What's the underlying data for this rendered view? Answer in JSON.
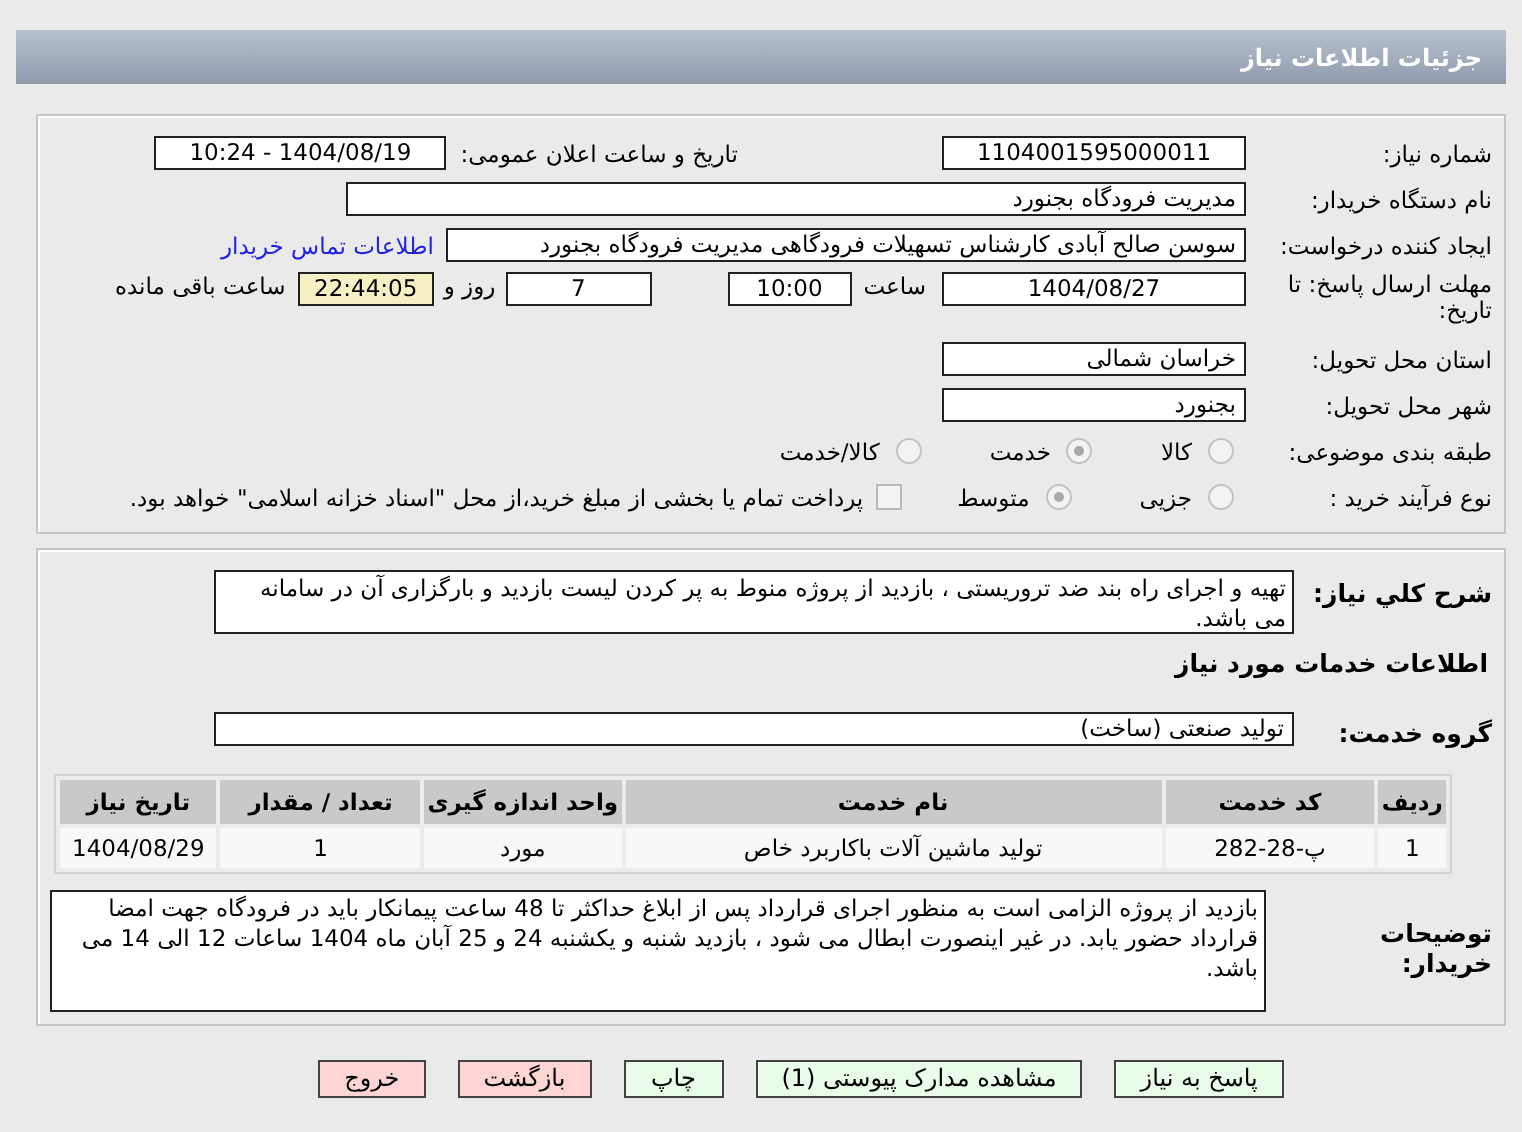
{
  "header": {
    "title": "جزئیات اطلاعات نیاز"
  },
  "details": {
    "need_number": {
      "label": "شماره نیاز:",
      "value": "1104001595000011"
    },
    "announce": {
      "label": "تاریخ و ساعت اعلان عمومی:",
      "value": "1404/08/19 - 10:24"
    },
    "buyer": {
      "label": "نام دستگاه خریدار:",
      "value": "مدیریت فرودگاه بجنورد"
    },
    "creator": {
      "label": "ایجاد کننده درخواست:",
      "value": "سوسن صالح آبادی کارشناس تسهیلات فرودگاهی مدیریت فرودگاه بجنورد",
      "link": "اطلاعات تماس خریدار"
    },
    "deadline": {
      "label": "مهلت ارسال پاسخ: تا تاریخ:",
      "date": "1404/08/27",
      "time_label": "ساعت",
      "time": "10:00",
      "days": "7",
      "days_label": "روز و",
      "remaining": "22:44:05",
      "remaining_label": "ساعت باقی مانده"
    },
    "province": {
      "label": "استان محل تحویل:",
      "value": "خراسان شمالی"
    },
    "city": {
      "label": "شهر محل تحویل:",
      "value": "بجنورد"
    },
    "category": {
      "label": "طبقه بندی موضوعی:",
      "options": [
        {
          "label": "کالا",
          "selected": false
        },
        {
          "label": "خدمت",
          "selected": true
        },
        {
          "label": "کالا/خدمت",
          "selected": false
        }
      ]
    },
    "process": {
      "label": "نوع فرآیند خرید :",
      "options": [
        {
          "label": "جزیی",
          "selected": false
        },
        {
          "label": "متوسط",
          "selected": true
        }
      ],
      "payment": {
        "checked": false,
        "text": "پرداخت تمام یا بخشی از مبلغ خرید،از محل \"اسناد خزانه اسلامی\" خواهد بود."
      }
    }
  },
  "services": {
    "description": {
      "label": "شرح کلي نياز:",
      "value": "تهیه و اجرای راه بند ضد تروریستی ، بازدید از پروژه منوط به پر کردن لیست بازدید و بارگزاری آن در سامانه می باشد."
    },
    "heading": "اطلاعات خدمات مورد نیاز",
    "group": {
      "label": "گروه خدمت:",
      "value": "تولید صنعتی (ساخت)"
    },
    "table": {
      "columns": [
        "ردیف",
        "کد خدمت",
        "نام خدمت",
        "واحد اندازه گیری",
        "تعداد / مقدار",
        "تاریخ نیاز"
      ],
      "rows": [
        [
          "1",
          "پ-28-282",
          "تولید ماشین آلات باکاربرد خاص",
          "مورد",
          "1",
          "1404/08/29"
        ]
      ]
    },
    "notes": {
      "label": "توضیحات خریدار:",
      "value": "بازدید از پروژه الزامی است به منظور اجرای قرارداد پس از ابلاغ حداکثر تا 48 ساعت پیمانکار باید در فرودگاه جهت امضا قرارداد حضور یابد. در غیر اینصورت ابطال می شود ، بازدید شنبه و یکشنبه 24 و 25 آبان ماه 1404 ساعات 12 الی 14 می باشد."
    }
  },
  "buttons": [
    {
      "label": "پاسخ به نیاز",
      "kind": "normal"
    },
    {
      "label": "مشاهده مدارک پیوستی (1)",
      "kind": "normal"
    },
    {
      "label": "چاپ",
      "kind": "normal"
    },
    {
      "label": "بازگشت",
      "kind": "danger"
    },
    {
      "label": "خروج",
      "kind": "danger"
    }
  ]
}
